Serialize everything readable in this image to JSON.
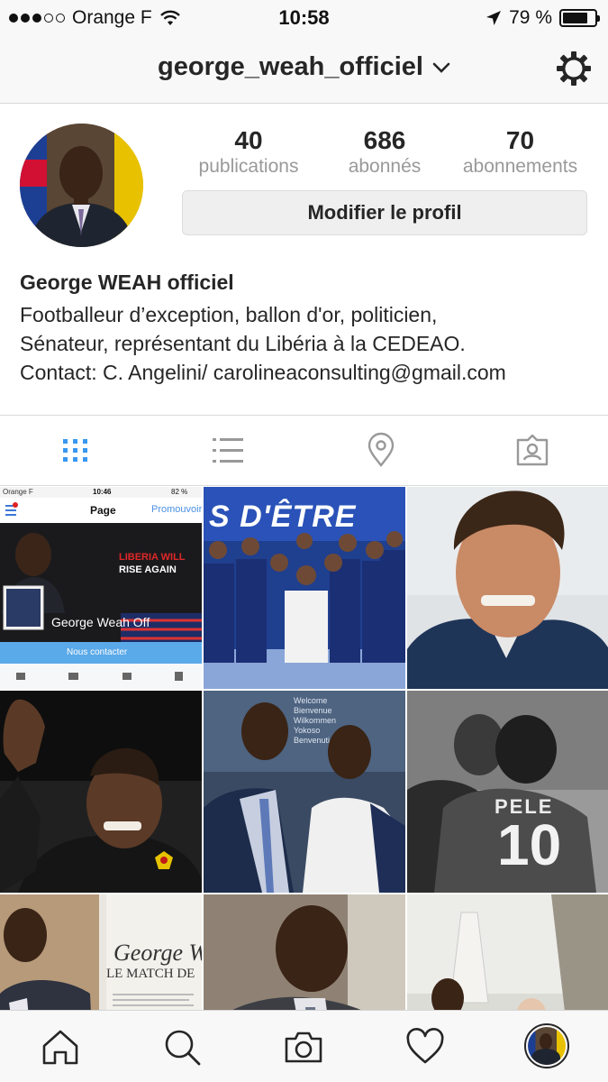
{
  "status_bar": {
    "carrier": "Orange F",
    "time": "10:58",
    "battery": "79 %",
    "battery_level": 0.79
  },
  "header": {
    "username": "george_weah_officiel",
    "settings_icon": "gear-icon",
    "dropdown_icon": "chevron-down-icon"
  },
  "profile": {
    "stats": [
      {
        "value": "40",
        "label": "publications"
      },
      {
        "value": "686",
        "label": "abonnés"
      },
      {
        "value": "70",
        "label": "abonnements"
      }
    ],
    "edit_button": "Modifier le profil",
    "name": "George WEAH officiel",
    "bio_lines": [
      "Footballeur d’exception, ballon d'or, politicien,",
      "Sénateur, représentant du Libéria à la CEDEAO.",
      "Contact: C. Angelini/ carolineaconsulting@gmail.com"
    ]
  },
  "tabs": [
    {
      "icon": "grid-icon",
      "active": true
    },
    {
      "icon": "list-icon",
      "active": false
    },
    {
      "icon": "location-pin-icon",
      "active": false
    },
    {
      "icon": "tagged-person-icon",
      "active": false
    }
  ],
  "grid_posts": {
    "post1": {
      "status_carrier": "Orange F",
      "status_time": "10:46",
      "status_battery": "82 %",
      "page_title": "Page",
      "promote": "Promouvoir",
      "banner_line1": "LIBERIA WILL",
      "banner_line2": "RISE AGAIN",
      "page_name": "George Weah Off",
      "contact": "Nous contacter"
    },
    "post2": {
      "text": "S D'ÊTRE"
    },
    "post5": {
      "words": [
        "Welcome",
        "Bienvenue",
        "Wilkommen",
        "Yokoso",
        "Benvenuti"
      ]
    },
    "post6": {
      "jersey_name": "PELE",
      "jersey_number": "10"
    },
    "post7": {
      "headline": "George W",
      "subline": "LE MATCH DE"
    }
  },
  "bottom_nav": [
    {
      "icon": "home-icon"
    },
    {
      "icon": "search-icon"
    },
    {
      "icon": "camera-icon"
    },
    {
      "icon": "heart-icon"
    },
    {
      "icon": "profile-avatar-icon"
    }
  ],
  "colors": {
    "text": "#262626",
    "muted": "#999999",
    "accent": "#3897f0",
    "bar_bg": "#f8f8f8"
  }
}
